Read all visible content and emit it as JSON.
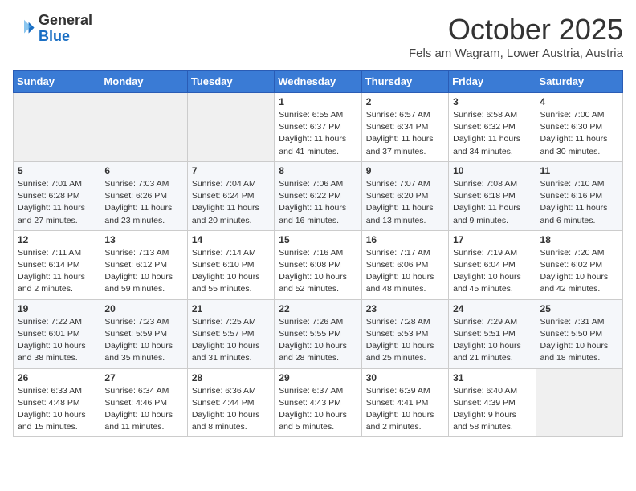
{
  "header": {
    "logo_general": "General",
    "logo_blue": "Blue",
    "month_title": "October 2025",
    "location": "Fels am Wagram, Lower Austria, Austria"
  },
  "weekdays": [
    "Sunday",
    "Monday",
    "Tuesday",
    "Wednesday",
    "Thursday",
    "Friday",
    "Saturday"
  ],
  "weeks": [
    [
      {
        "day": "",
        "info": ""
      },
      {
        "day": "",
        "info": ""
      },
      {
        "day": "",
        "info": ""
      },
      {
        "day": "1",
        "info": "Sunrise: 6:55 AM\nSunset: 6:37 PM\nDaylight: 11 hours\nand 41 minutes."
      },
      {
        "day": "2",
        "info": "Sunrise: 6:57 AM\nSunset: 6:34 PM\nDaylight: 11 hours\nand 37 minutes."
      },
      {
        "day": "3",
        "info": "Sunrise: 6:58 AM\nSunset: 6:32 PM\nDaylight: 11 hours\nand 34 minutes."
      },
      {
        "day": "4",
        "info": "Sunrise: 7:00 AM\nSunset: 6:30 PM\nDaylight: 11 hours\nand 30 minutes."
      }
    ],
    [
      {
        "day": "5",
        "info": "Sunrise: 7:01 AM\nSunset: 6:28 PM\nDaylight: 11 hours\nand 27 minutes."
      },
      {
        "day": "6",
        "info": "Sunrise: 7:03 AM\nSunset: 6:26 PM\nDaylight: 11 hours\nand 23 minutes."
      },
      {
        "day": "7",
        "info": "Sunrise: 7:04 AM\nSunset: 6:24 PM\nDaylight: 11 hours\nand 20 minutes."
      },
      {
        "day": "8",
        "info": "Sunrise: 7:06 AM\nSunset: 6:22 PM\nDaylight: 11 hours\nand 16 minutes."
      },
      {
        "day": "9",
        "info": "Sunrise: 7:07 AM\nSunset: 6:20 PM\nDaylight: 11 hours\nand 13 minutes."
      },
      {
        "day": "10",
        "info": "Sunrise: 7:08 AM\nSunset: 6:18 PM\nDaylight: 11 hours\nand 9 minutes."
      },
      {
        "day": "11",
        "info": "Sunrise: 7:10 AM\nSunset: 6:16 PM\nDaylight: 11 hours\nand 6 minutes."
      }
    ],
    [
      {
        "day": "12",
        "info": "Sunrise: 7:11 AM\nSunset: 6:14 PM\nDaylight: 11 hours\nand 2 minutes."
      },
      {
        "day": "13",
        "info": "Sunrise: 7:13 AM\nSunset: 6:12 PM\nDaylight: 10 hours\nand 59 minutes."
      },
      {
        "day": "14",
        "info": "Sunrise: 7:14 AM\nSunset: 6:10 PM\nDaylight: 10 hours\nand 55 minutes."
      },
      {
        "day": "15",
        "info": "Sunrise: 7:16 AM\nSunset: 6:08 PM\nDaylight: 10 hours\nand 52 minutes."
      },
      {
        "day": "16",
        "info": "Sunrise: 7:17 AM\nSunset: 6:06 PM\nDaylight: 10 hours\nand 48 minutes."
      },
      {
        "day": "17",
        "info": "Sunrise: 7:19 AM\nSunset: 6:04 PM\nDaylight: 10 hours\nand 45 minutes."
      },
      {
        "day": "18",
        "info": "Sunrise: 7:20 AM\nSunset: 6:02 PM\nDaylight: 10 hours\nand 42 minutes."
      }
    ],
    [
      {
        "day": "19",
        "info": "Sunrise: 7:22 AM\nSunset: 6:01 PM\nDaylight: 10 hours\nand 38 minutes."
      },
      {
        "day": "20",
        "info": "Sunrise: 7:23 AM\nSunset: 5:59 PM\nDaylight: 10 hours\nand 35 minutes."
      },
      {
        "day": "21",
        "info": "Sunrise: 7:25 AM\nSunset: 5:57 PM\nDaylight: 10 hours\nand 31 minutes."
      },
      {
        "day": "22",
        "info": "Sunrise: 7:26 AM\nSunset: 5:55 PM\nDaylight: 10 hours\nand 28 minutes."
      },
      {
        "day": "23",
        "info": "Sunrise: 7:28 AM\nSunset: 5:53 PM\nDaylight: 10 hours\nand 25 minutes."
      },
      {
        "day": "24",
        "info": "Sunrise: 7:29 AM\nSunset: 5:51 PM\nDaylight: 10 hours\nand 21 minutes."
      },
      {
        "day": "25",
        "info": "Sunrise: 7:31 AM\nSunset: 5:50 PM\nDaylight: 10 hours\nand 18 minutes."
      }
    ],
    [
      {
        "day": "26",
        "info": "Sunrise: 6:33 AM\nSunset: 4:48 PM\nDaylight: 10 hours\nand 15 minutes."
      },
      {
        "day": "27",
        "info": "Sunrise: 6:34 AM\nSunset: 4:46 PM\nDaylight: 10 hours\nand 11 minutes."
      },
      {
        "day": "28",
        "info": "Sunrise: 6:36 AM\nSunset: 4:44 PM\nDaylight: 10 hours\nand 8 minutes."
      },
      {
        "day": "29",
        "info": "Sunrise: 6:37 AM\nSunset: 4:43 PM\nDaylight: 10 hours\nand 5 minutes."
      },
      {
        "day": "30",
        "info": "Sunrise: 6:39 AM\nSunset: 4:41 PM\nDaylight: 10 hours\nand 2 minutes."
      },
      {
        "day": "31",
        "info": "Sunrise: 6:40 AM\nSunset: 4:39 PM\nDaylight: 9 hours\nand 58 minutes."
      },
      {
        "day": "",
        "info": ""
      }
    ]
  ]
}
